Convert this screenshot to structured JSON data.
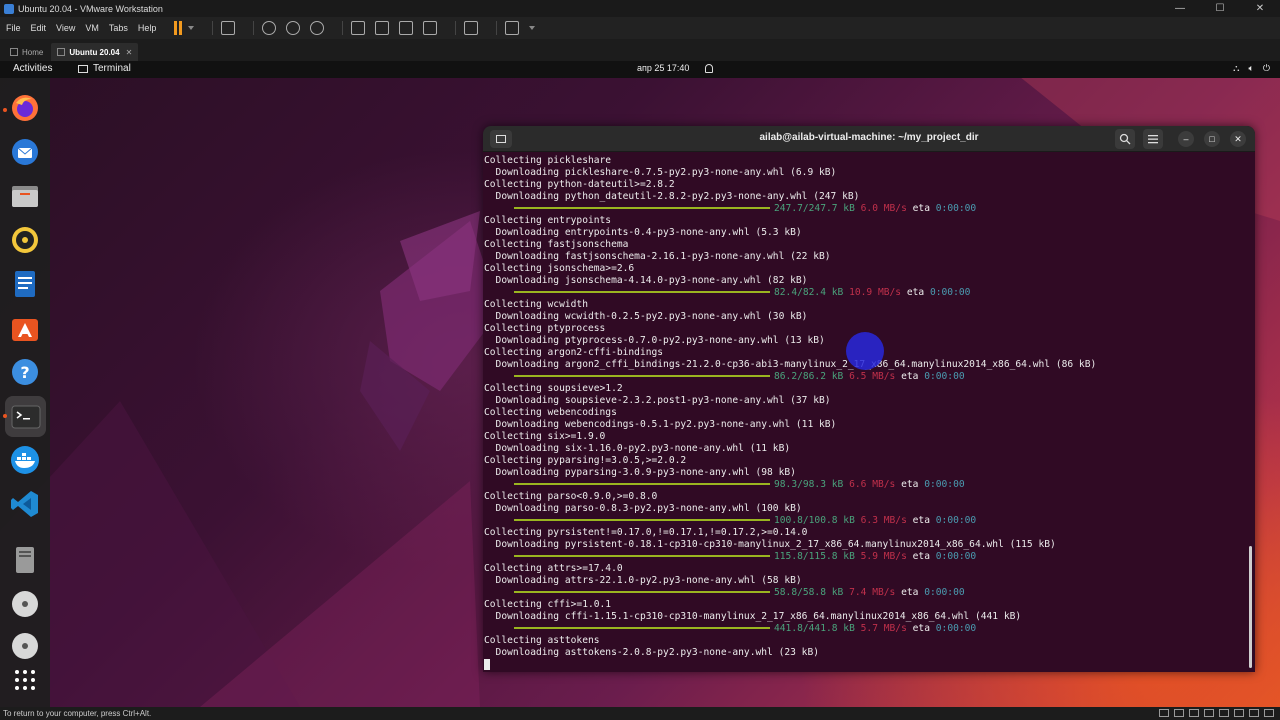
{
  "vmware": {
    "title": "Ubuntu 20.04 - VMware Workstation",
    "menu": [
      "File",
      "Edit",
      "View",
      "VM",
      "Tabs",
      "Help"
    ],
    "tabs": [
      {
        "label": "Home",
        "active": false
      },
      {
        "label": "Ubuntu 20.04",
        "active": true
      }
    ],
    "status_text": "To return to your computer, press Ctrl+Alt."
  },
  "ubuntu": {
    "topbar": {
      "activities": "Activities",
      "app_name": "Terminal",
      "clock": "апр 25  17:40"
    },
    "dock_icons": [
      "firefox-icon",
      "thunderbird-icon",
      "files-icon",
      "rhythmbox-icon",
      "writer-icon",
      "software-icon",
      "help-icon",
      "terminal-icon",
      "docker-icon",
      "vscode-icon",
      "disk-icon",
      "dvd-icon",
      "dvd-icon",
      "app-grid-icon"
    ]
  },
  "terminal": {
    "title": "ailab@ailab-virtual-machine: ~/my_project_dir",
    "lines": [
      {
        "t": "Collecting pickleshare"
      },
      {
        "t": "  Downloading pickleshare-0.7.5-py2.py3-none-any.whl (6.9 kB)"
      },
      {
        "t": "Collecting python-dateutil>=2.8.2"
      },
      {
        "t": "  Downloading python_dateutil-2.8.2-py2.py3-none-any.whl (247 kB)"
      },
      {
        "p": "247.7/247.7 kB",
        "s": "6.0 MB/s",
        "e": "0:00:00"
      },
      {
        "t": "Collecting entrypoints"
      },
      {
        "t": "  Downloading entrypoints-0.4-py3-none-any.whl (5.3 kB)"
      },
      {
        "t": "Collecting fastjsonschema"
      },
      {
        "t": "  Downloading fastjsonschema-2.16.1-py3-none-any.whl (22 kB)"
      },
      {
        "t": "Collecting jsonschema>=2.6"
      },
      {
        "t": "  Downloading jsonschema-4.14.0-py3-none-any.whl (82 kB)"
      },
      {
        "p": "82.4/82.4 kB",
        "s": "10.9 MB/s",
        "e": "0:00:00"
      },
      {
        "t": "Collecting wcwidth"
      },
      {
        "t": "  Downloading wcwidth-0.2.5-py2.py3-none-any.whl (30 kB)"
      },
      {
        "t": "Collecting ptyprocess"
      },
      {
        "t": "  Downloading ptyprocess-0.7.0-py2.py3-none-any.whl (13 kB)"
      },
      {
        "t": "Collecting argon2-cffi-bindings"
      },
      {
        "t": "  Downloading argon2_cffi_bindings-21.2.0-cp36-abi3-manylinux_2_17_x86_64.manylinux2014_x86_64.whl (86 kB)"
      },
      {
        "p": "86.2/86.2 kB",
        "s": "6.5 MB/s",
        "e": "0:00:00"
      },
      {
        "t": "Collecting soupsieve>1.2"
      },
      {
        "t": "  Downloading soupsieve-2.3.2.post1-py3-none-any.whl (37 kB)"
      },
      {
        "t": "Collecting webencodings"
      },
      {
        "t": "  Downloading webencodings-0.5.1-py2.py3-none-any.whl (11 kB)"
      },
      {
        "t": "Collecting six>=1.9.0"
      },
      {
        "t": "  Downloading six-1.16.0-py2.py3-none-any.whl (11 kB)"
      },
      {
        "t": "Collecting pyparsing!=3.0.5,>=2.0.2"
      },
      {
        "t": "  Downloading pyparsing-3.0.9-py3-none-any.whl (98 kB)"
      },
      {
        "p": "98.3/98.3 kB",
        "s": "6.6 MB/s",
        "e": "0:00:00"
      },
      {
        "t": "Collecting parso<0.9.0,>=0.8.0"
      },
      {
        "t": "  Downloading parso-0.8.3-py2.py3-none-any.whl (100 kB)"
      },
      {
        "p": "100.8/100.8 kB",
        "s": "6.3 MB/s",
        "e": "0:00:00"
      },
      {
        "t": "Collecting pyrsistent!=0.17.0,!=0.17.1,!=0.17.2,>=0.14.0"
      },
      {
        "t": "  Downloading pyrsistent-0.18.1-cp310-cp310-manylinux_2_17_x86_64.manylinux2014_x86_64.whl (115 kB)"
      },
      {
        "p": "115.8/115.8 kB",
        "s": "5.9 MB/s",
        "e": "0:00:00"
      },
      {
        "t": "Collecting attrs>=17.4.0"
      },
      {
        "t": "  Downloading attrs-22.1.0-py2.py3-none-any.whl (58 kB)"
      },
      {
        "p": "58.8/58.8 kB",
        "s": "7.4 MB/s",
        "e": "0:00:00"
      },
      {
        "t": "Collecting cffi>=1.0.1"
      },
      {
        "t": "  Downloading cffi-1.15.1-cp310-cp310-manylinux_2_17_x86_64.manylinux2014_x86_64.whl (441 kB)"
      },
      {
        "p": "441.8/441.8 kB",
        "s": "5.7 MB/s",
        "e": "0:00:00"
      },
      {
        "t": "Collecting asttokens"
      },
      {
        "t": "  Downloading asttokens-2.0.8-py2.py3-none-any.whl (23 kB)"
      }
    ],
    "eta_label": "eta"
  },
  "colors": {
    "terminal_bg": "#300a24",
    "progress_bar": "#9ab520",
    "progress_text": "#4aa37c",
    "speed_text": "#c0304b",
    "eta_text": "#4a9bb0",
    "ubuntu_orange": "#e95420",
    "vmware_pause": "#f29a1f"
  }
}
